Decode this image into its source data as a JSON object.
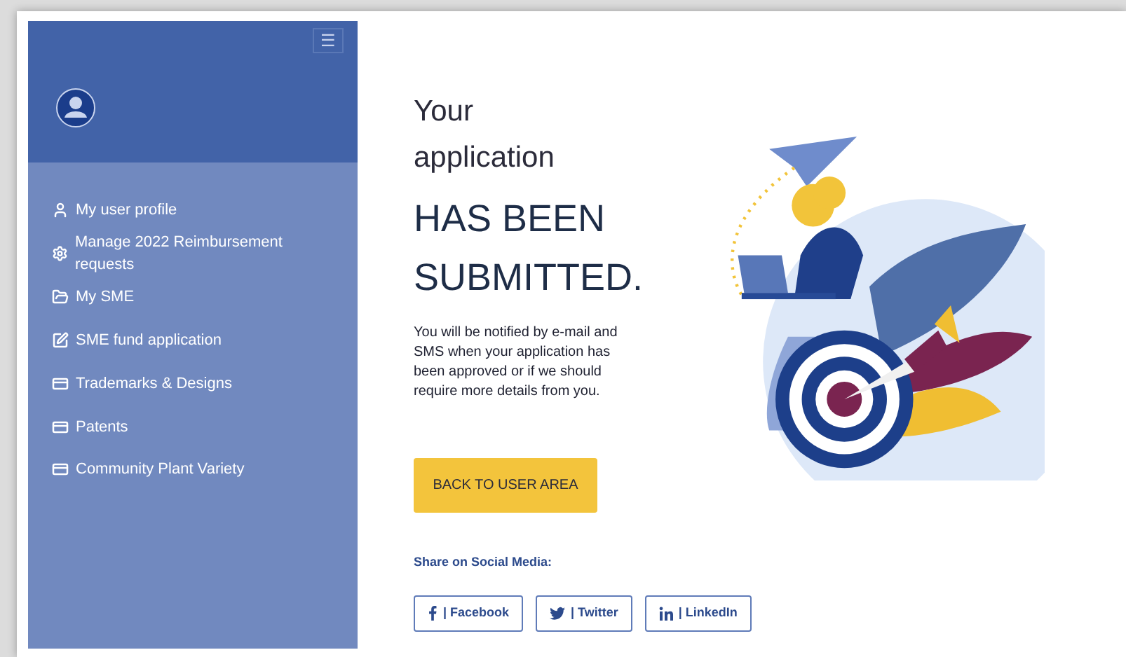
{
  "sidebar": {
    "menu_button": "☰",
    "items": [
      {
        "label": "My user profile"
      },
      {
        "label": "Manage 2022 Reimbursement requests"
      },
      {
        "label": "My SME"
      },
      {
        "label": "SME fund application"
      },
      {
        "label": "Trademarks & Designs"
      },
      {
        "label": "Patents"
      },
      {
        "label": "Community Plant Variety"
      }
    ]
  },
  "heading": {
    "line_1": "Your",
    "line_2": "application",
    "line_3": "HAS BEEN",
    "line_4": "SUBMITTED."
  },
  "message": "You will be notified by e-mail and SMS when your application has been approved or if we should require more details from you.",
  "back_button": "BACK TO USER AREA",
  "share": {
    "label": "Share on Social Media:",
    "buttons": [
      {
        "label": "| Facebook"
      },
      {
        "label": "| Twitter"
      },
      {
        "label": "| LinkedIn"
      }
    ]
  }
}
